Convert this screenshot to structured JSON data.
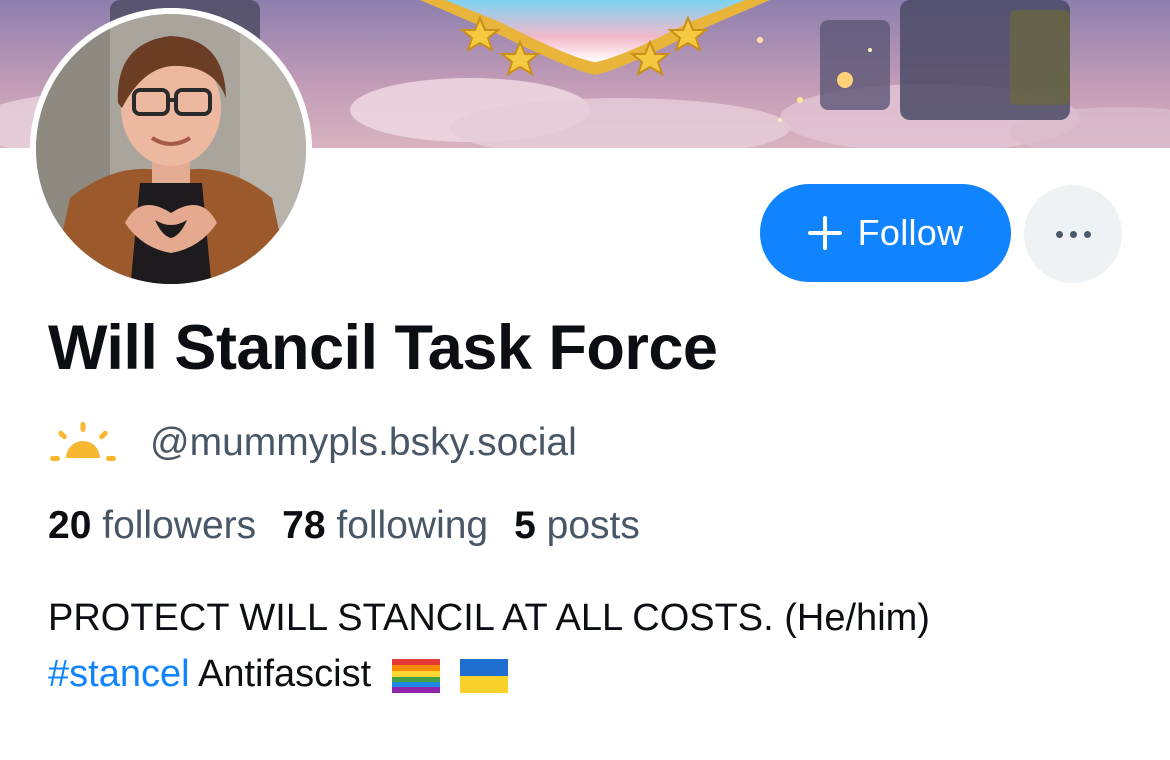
{
  "profile": {
    "display_name": "Will Stancil Task Force",
    "handle": "@mummypls.bsky.social",
    "handle_icon": "sunrise-icon"
  },
  "actions": {
    "follow_label": "Follow",
    "follow_icon": "plus-icon",
    "more_icon": "more-horizontal-icon"
  },
  "stats": [
    {
      "count": "20",
      "label": "followers"
    },
    {
      "count": "78",
      "label": "following"
    },
    {
      "count": "5",
      "label": "posts"
    }
  ],
  "bio": {
    "line1": "PROTECT WILL STANCIL AT ALL COSTS. (He/him)",
    "hashtag": "#stancel",
    "after_hashtag": " Antifascist",
    "emojis": [
      "rainbow-flag-icon",
      "ukraine-flag-icon"
    ]
  },
  "colors": {
    "accent": "#1083fe",
    "text": "#0b0f14",
    "muted": "#485666",
    "more_bg": "#eef2f5",
    "sun": "#f7b731"
  }
}
